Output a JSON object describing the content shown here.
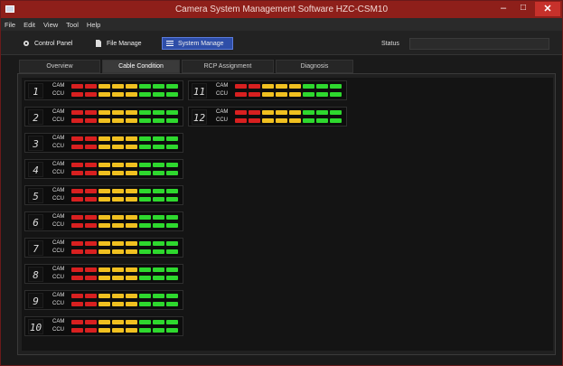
{
  "window": {
    "title": "Camera System Management Software HZC-CSM10",
    "min_label": "–",
    "max_label": "□",
    "close_label": "✕"
  },
  "menu": [
    "File",
    "Edit",
    "View",
    "Tool",
    "Help"
  ],
  "toolbar": {
    "control_panel": "Control Panel",
    "file_manage": "File Manage",
    "system_manage": "System Manage",
    "status_label": "Status",
    "status_value": ""
  },
  "tabs": [
    "Overview",
    "Cable Condition",
    "RCP Assignment",
    "Diagnosis"
  ],
  "active_tab": "Cable Condition",
  "labels": {
    "cam": "CAM",
    "ccu": "CCU"
  },
  "colors": {
    "red": "#d82020",
    "yellow": "#f0c020",
    "green": "#2ed82e",
    "accent": "#2e4ea8"
  },
  "cables": [
    {
      "id": "1"
    },
    {
      "id": "2"
    },
    {
      "id": "3"
    },
    {
      "id": "4"
    },
    {
      "id": "5"
    },
    {
      "id": "6"
    },
    {
      "id": "7"
    },
    {
      "id": "8"
    },
    {
      "id": "9"
    },
    {
      "id": "10"
    },
    {
      "id": "11"
    },
    {
      "id": "12"
    }
  ]
}
